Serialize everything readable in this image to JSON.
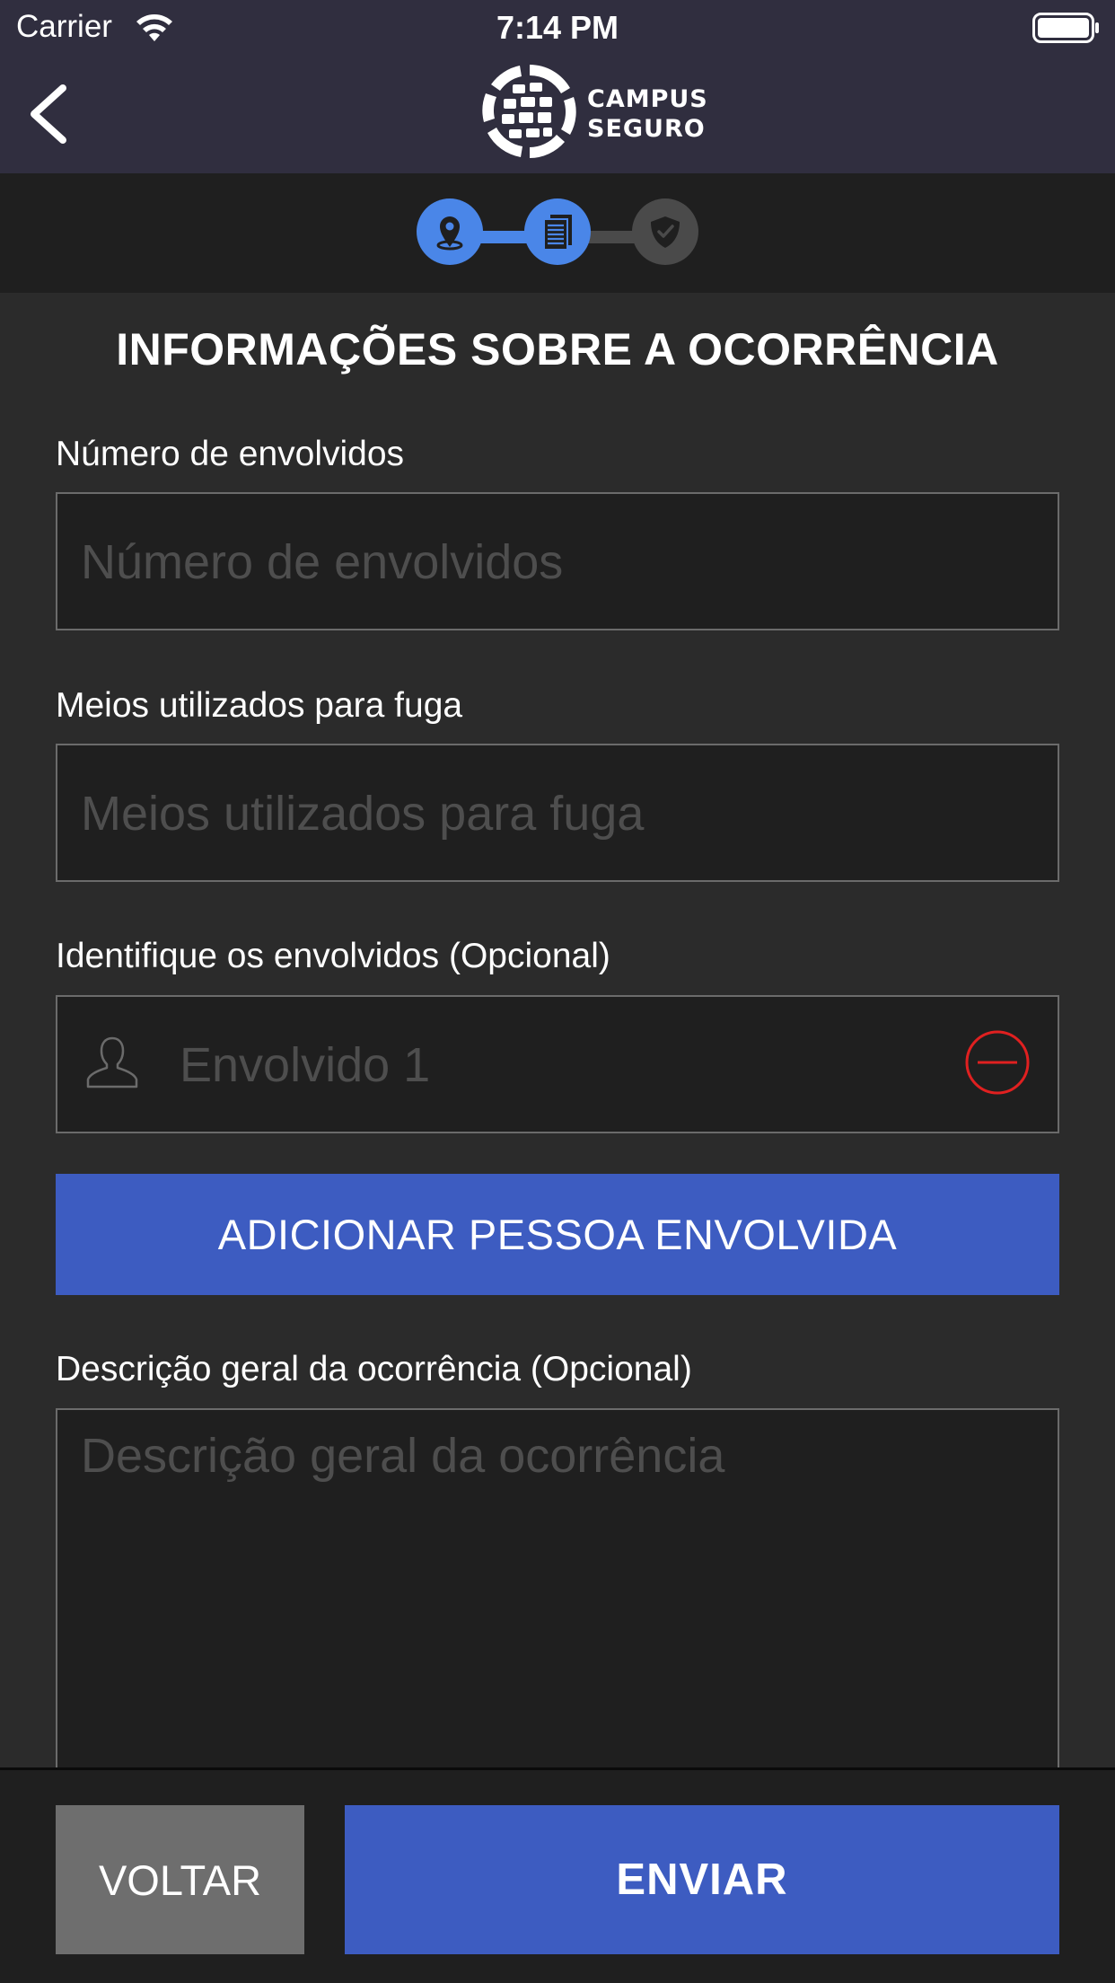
{
  "status_bar": {
    "carrier": "Carrier",
    "time": "7:14 PM"
  },
  "nav": {
    "back_icon": "chevron-left-icon",
    "logo_line1": "CAMPUS",
    "logo_line2": "SEGURO"
  },
  "stepper": {
    "steps": [
      {
        "icon": "map-pin-icon",
        "state": "completed"
      },
      {
        "icon": "document-icon",
        "state": "active"
      },
      {
        "icon": "shield-check-icon",
        "state": "pending"
      }
    ],
    "colors": {
      "active": "#4a86e8",
      "pending": "#4a4a4a"
    }
  },
  "form": {
    "title": "INFORMAÇÕES SOBRE A OCORRÊNCIA",
    "involved_count": {
      "label": "Número de envolvidos",
      "placeholder": "Número de envolvidos",
      "value": ""
    },
    "escape_means": {
      "label": "Meios utilizados para fuga",
      "placeholder": "Meios utilizados para fuga",
      "value": ""
    },
    "identify": {
      "label": "Identifique os envolvidos (Opcional)",
      "people": [
        {
          "placeholder": "Envolvido 1",
          "value": ""
        }
      ],
      "add_button": "ADICIONAR PESSOA ENVOLVIDA"
    },
    "description": {
      "label": "Descrição geral da ocorrência (Opcional)",
      "placeholder": "Descrição geral da ocorrência",
      "value": ""
    }
  },
  "footer": {
    "back_label": "VOLTAR",
    "send_label": "ENVIAR"
  },
  "colors": {
    "header_bg": "#302e3f",
    "primary": "#3d5cc1",
    "remove": "#e02020",
    "secondary_button": "#6e6e6e"
  }
}
